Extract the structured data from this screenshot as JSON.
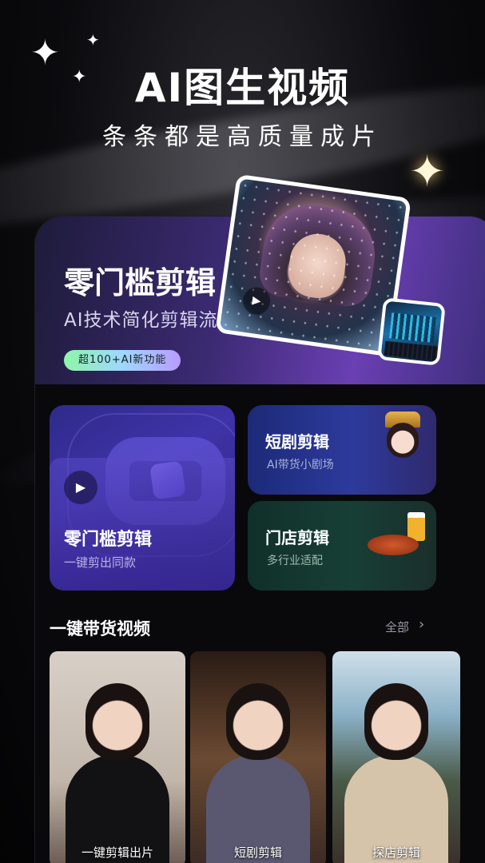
{
  "hero": {
    "title": "AI图生视频",
    "subtitle": "条条都是高质量成片"
  },
  "banner": {
    "title": "零门槛剪辑",
    "subtitle": "AI技术简化剪辑流程",
    "badge": "超100+AI新功能"
  },
  "features": {
    "big": {
      "title": "零门槛剪辑",
      "subtitle": "一键剪出同款"
    },
    "drama": {
      "title": "短剧剪辑",
      "subtitle": "AI带货小剧场"
    },
    "store": {
      "title": "门店剪辑",
      "subtitle": "多行业适配"
    }
  },
  "section": {
    "title": "一键带货视频",
    "all_label": "全部",
    "chevron": "›"
  },
  "thumbnails": [
    {
      "caption": "一键剪辑出片"
    },
    {
      "caption": "短剧剪辑"
    },
    {
      "caption": "探店剪辑"
    }
  ],
  "icons": {
    "sparkle": "✦",
    "play": "▶"
  },
  "colors": {
    "accent": "#6a3fb3",
    "badge_start": "#8ff5a8",
    "badge_end": "#b89bff"
  }
}
